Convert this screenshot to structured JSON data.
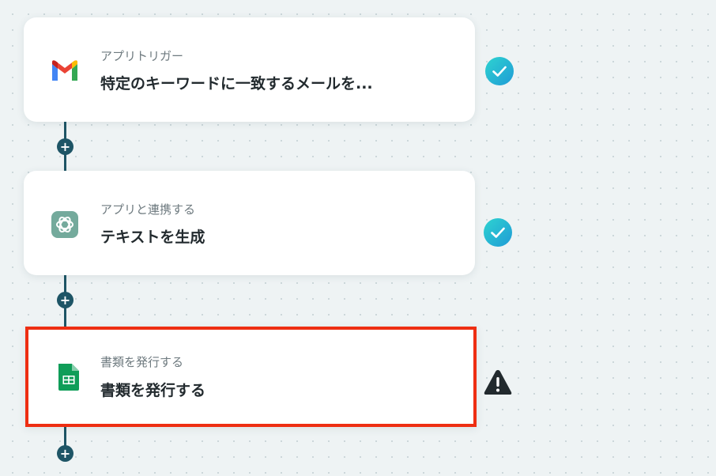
{
  "steps": [
    {
      "subtitle": "アプリトリガー",
      "title": "特定のキーワードに一致するメールを...",
      "icon": "gmail-icon",
      "status": "complete"
    },
    {
      "subtitle": "アプリと連携する",
      "title": "テキストを生成",
      "icon": "chatgpt-icon",
      "status": "complete"
    },
    {
      "subtitle": "書類を発行する",
      "title": "書類を発行する",
      "icon": "google-sheets-icon",
      "status": "warning"
    }
  ],
  "add_button_label": "+",
  "colors": {
    "connector": "#1e5566",
    "check_gradient_start": "#2ed3d0",
    "check_gradient_end": "#1f9bd6",
    "selection_border": "#ee2e12",
    "warning": "#222a2e"
  }
}
